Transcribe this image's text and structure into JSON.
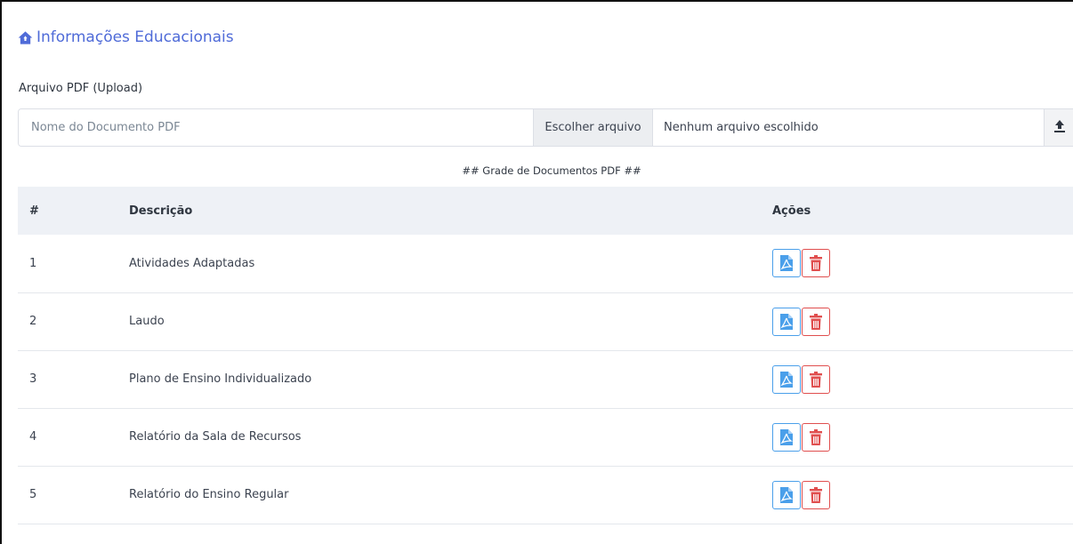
{
  "page": {
    "title": "Informações Educacionais",
    "title_icon": "home-icon"
  },
  "upload": {
    "label": "Arquivo PDF (Upload)",
    "name_placeholder": "Nome do Documento PDF",
    "name_value": "",
    "choose_label": "Escolher arquivo",
    "file_status": "Nenhum arquivo escolhido",
    "upload_icon": "upload-icon"
  },
  "grid": {
    "caption": "## Grade de Documentos PDF ##",
    "headers": {
      "num": "#",
      "desc": "Descrição",
      "actions": "Ações"
    },
    "rows": [
      {
        "num": "1",
        "desc": "Atividades Adaptadas"
      },
      {
        "num": "2",
        "desc": "Laudo"
      },
      {
        "num": "3",
        "desc": "Plano de Ensino Individualizado"
      },
      {
        "num": "4",
        "desc": "Relatório da Sala de Recursos"
      },
      {
        "num": "5",
        "desc": "Relatório do Ensino Regular"
      }
    ],
    "action_icons": {
      "view": "pdf-icon",
      "delete": "trash-icon"
    }
  },
  "colors": {
    "accent": "#4f6bd8",
    "pdf_blue": "#4a9fea",
    "delete_red": "#e04e4e",
    "header_bg": "#eef1f6"
  }
}
